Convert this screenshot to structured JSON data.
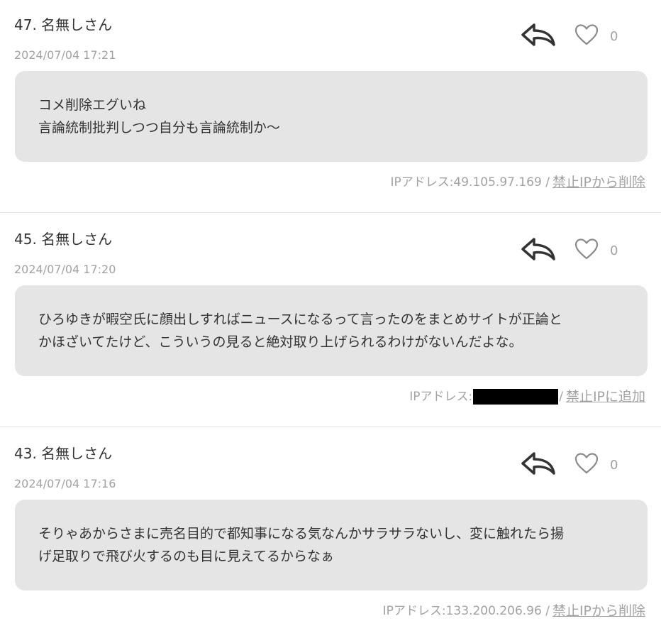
{
  "comments": [
    {
      "author": "47. 名無しさん",
      "date": "2024/07/04 17:21",
      "likes": "0",
      "lines": [
        "コメ削除エグいね",
        "言論統制批判しつつ自分も言論統制か〜"
      ],
      "ip_label": "IPアドレス:49.105.97.169 /",
      "action": "禁止IPから削除"
    },
    {
      "author": "45. 名無しさん",
      "date": "2024/07/04 17:20",
      "likes": "0",
      "lines": [
        "ひろゆきが暇空氏に顔出しすればニュースになるって言ったのをまとめサイトが正論と",
        "かほざいてたけど、こういうの見ると絶対取り上げられるわけがないんだよな。"
      ],
      "ip_label": "IPアドレス:",
      "ip_after": "/",
      "action": "禁止IPに追加"
    },
    {
      "author": "43. 名無しさん",
      "date": "2024/07/04 17:16",
      "likes": "0",
      "lines": [
        "そりゃあからさまに売名目的で都知事になる気なんかサラサラないし、変に触れたら揚",
        "げ足取りで飛び火するのも目に見えてるからなぁ"
      ],
      "ip_label": "IPアドレス:133.200.206.96 /",
      "action": "禁止IPから削除"
    }
  ],
  "icons": {
    "reply": "reply-arrow-icon",
    "like": "heart-outline-icon"
  },
  "colors": {
    "bubble": "#e5e5e5",
    "muted": "#a2a2a2",
    "text": "#333333",
    "divider": "#e0e0e0"
  }
}
